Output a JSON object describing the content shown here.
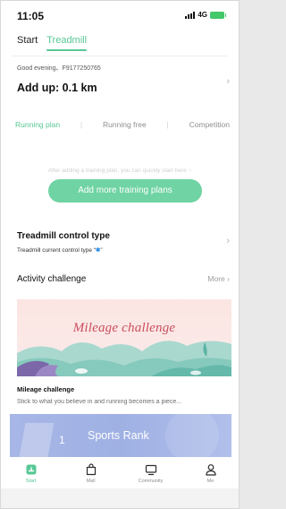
{
  "status_bar": {
    "time": "11:05",
    "network": "4G"
  },
  "header": {
    "tabs": [
      {
        "label": "Start",
        "active": false
      },
      {
        "label": "Treadmill",
        "active": true
      }
    ]
  },
  "summary": {
    "greeting": "Good evening、F9177250765",
    "addup": "Add up: 0.1 km"
  },
  "plan_tabs": [
    {
      "label": "Running plan",
      "active": true
    },
    {
      "label": "Running free",
      "active": false
    },
    {
      "label": "Competition",
      "active": false
    }
  ],
  "plan": {
    "hint": "After adding a training plan, you can quickly start here ~",
    "add_button": "Add more training plans"
  },
  "control": {
    "title": "Treadmill control type",
    "subtitle_prefix": "Treadmill current control type “",
    "subtitle_suffix": "”"
  },
  "activity": {
    "title": "Activity challenge",
    "more": "More"
  },
  "banner": {
    "text": "Mileage challenge"
  },
  "card": {
    "title": "Mileage challenge",
    "description": "Stick to what you believe in and running becomes a piece..."
  },
  "rank": {
    "number": "1",
    "label": "Sports Rank"
  },
  "bottom_nav": [
    {
      "label": "Start",
      "icon": "start-icon",
      "active": true
    },
    {
      "label": "Mall",
      "icon": "bag-icon",
      "active": false
    },
    {
      "label": "Community",
      "icon": "monitor-icon",
      "active": false
    },
    {
      "label": "Me",
      "icon": "person-icon",
      "active": false
    }
  ],
  "colors": {
    "accent": "#58c895",
    "button": "#6fd3a3",
    "banner_text": "#ca4d5c",
    "rank_bg": "#a7b6e6",
    "bluetooth": "#2a8fe8"
  }
}
